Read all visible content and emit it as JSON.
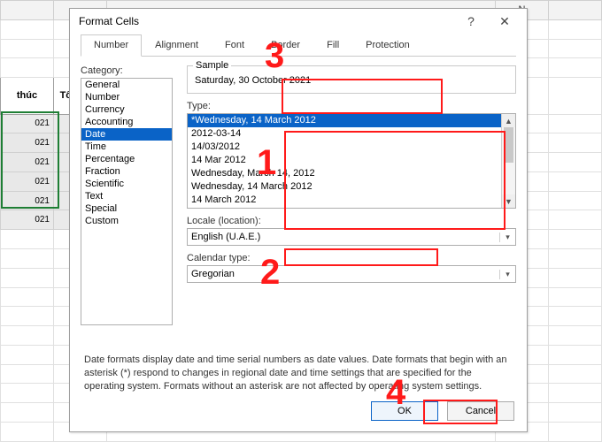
{
  "spreadsheet": {
    "col_header": "N",
    "headers": [
      "thúc",
      "Tổng làn"
    ],
    "rows": [
      "021",
      "021",
      "021",
      "021",
      "021",
      "021"
    ]
  },
  "dialog": {
    "title": "Format Cells",
    "tabs": [
      "Number",
      "Alignment",
      "Font",
      "Border",
      "Fill",
      "Protection"
    ],
    "category_label": "Category:",
    "categories": [
      "General",
      "Number",
      "Currency",
      "Accounting",
      "Date",
      "Time",
      "Percentage",
      "Fraction",
      "Scientific",
      "Text",
      "Special",
      "Custom"
    ],
    "selected_category": "Date",
    "sample_label": "Sample",
    "sample_value": "Saturday, 30 October 2021",
    "type_label": "Type:",
    "type_items": [
      "*Wednesday, 14 March 2012",
      "2012-03-14",
      "14/03/2012",
      "14 Mar 2012",
      "Wednesday, March 14, 2012",
      "Wednesday, 14 March 2012",
      "14 March 2012"
    ],
    "selected_type": "*Wednesday, 14 March 2012",
    "locale_label": "Locale (location):",
    "locale_value": "English (U.A.E.)",
    "calendar_label": "Calendar type:",
    "calendar_value": "Gregorian",
    "help_text": "Date formats display date and time serial numbers as date values.  Date formats that begin with an asterisk (*) respond to changes in regional date and time settings that are specified for the operating system. Formats without an asterisk are not affected by operating system settings.",
    "ok": "OK",
    "cancel": "Cancel"
  },
  "annotations": [
    "1",
    "2",
    "3",
    "4"
  ]
}
